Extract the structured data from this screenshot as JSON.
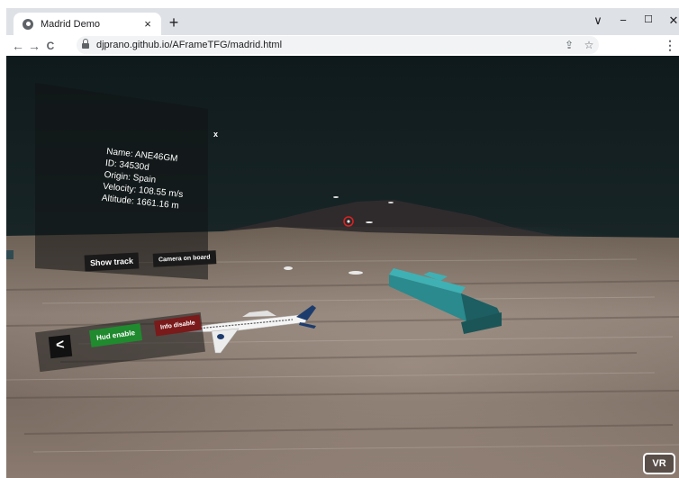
{
  "browser": {
    "tab_title": "Madrid Demo",
    "tab_close": "×",
    "new_tab": "+",
    "url": "djprano.github.io/AFrameTFG/madrid.html",
    "controls": {
      "dropdown": "∨",
      "minimize": "−",
      "maximize": "☐",
      "close": "✕"
    }
  },
  "toolbar": {
    "back": "←",
    "forward": "→",
    "reload": "C",
    "share_icon": "⇪",
    "star_icon": "☆",
    "menu_icon": "⋮"
  },
  "info_panel": {
    "close_label": "x",
    "name": "Name: ANE46GM",
    "id": "ID: 34530d",
    "origin": "Origin: Spain",
    "velocity": "Velocity: 108.55 m/s",
    "altitude": "Altitude: 1661.16 m",
    "show_track_label": "Show track",
    "camera_on_board_label": "Camera on board"
  },
  "hud": {
    "back_label": "<",
    "hud_enable_label": "Hud enable",
    "info_disable_label": "Info disable",
    "hud_enable_color": "#1f8a2e",
    "info_disable_color": "#7a1a1a"
  },
  "vr_label": "VR",
  "icons": [
    "globe-favicon-icon",
    "lock-icon",
    "share-icon",
    "star-icon",
    "kebab-menu-icon",
    "reticle-icon",
    "airplane-icon"
  ],
  "colors": {
    "sky": "#152225",
    "building": "#2a8a8e",
    "plane_tail": "#1d3c6e"
  }
}
